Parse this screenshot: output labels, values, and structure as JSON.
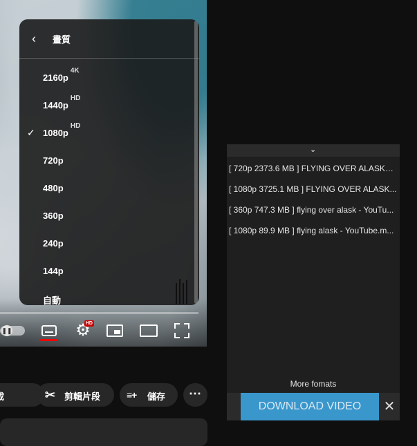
{
  "player": {
    "quality_menu": {
      "back_icon": "chevron-left-icon",
      "title": "畫質",
      "items": [
        {
          "label": "2160p",
          "badge": "4K",
          "selected": false
        },
        {
          "label": "1440p",
          "badge": "HD",
          "selected": false
        },
        {
          "label": "1080p",
          "badge": "HD",
          "selected": true
        },
        {
          "label": "720p",
          "badge": "",
          "selected": false
        },
        {
          "label": "480p",
          "badge": "",
          "selected": false
        },
        {
          "label": "360p",
          "badge": "",
          "selected": false
        },
        {
          "label": "240p",
          "badge": "",
          "selected": false
        },
        {
          "label": "144p",
          "badge": "",
          "selected": false
        },
        {
          "label": "自動",
          "badge": "",
          "selected": false
        }
      ],
      "check_icon": "checkmark-icon"
    },
    "controls": {
      "autoplay_icon": "pause-icon",
      "subtitles_icon": "subtitles-icon",
      "settings_icon": "gear-icon",
      "settings_badge": "HD",
      "miniplayer_icon": "miniplayer-icon",
      "theater_icon": "theater-mode-icon",
      "fullscreen_icon": "fullscreen-icon"
    }
  },
  "actions": {
    "download_label": "下載",
    "clip_label": "剪輯片段",
    "save_label": "儲存",
    "more_label": "⋯"
  },
  "downloader": {
    "collapse_icon": "chevron-down-icon",
    "formats": [
      {
        "text": "[ 720p 2373.6 MB ]  FLYING OVER ALASKA ..."
      },
      {
        "text": "[ 1080p 3725.1 MB ]  FLYING OVER ALASK..."
      },
      {
        "text": "[ 360p 747.3 MB ]  flying over alask - YouTu..."
      },
      {
        "text": "[ 1080p 89.9 MB ]  flying alask - YouTube.m..."
      }
    ],
    "more_formats": "More fomats",
    "download_button": "DOWNLOAD VIDEO",
    "close_label": "✕",
    "accent_color": "#3a97cc"
  }
}
